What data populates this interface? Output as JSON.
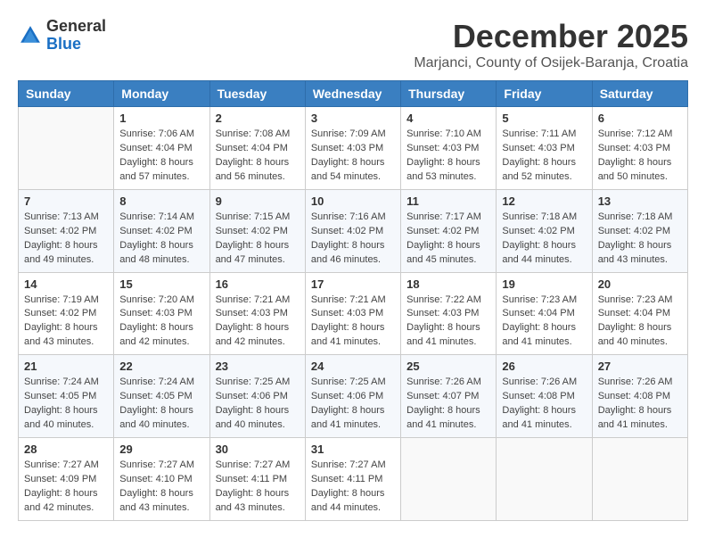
{
  "header": {
    "logo_general": "General",
    "logo_blue": "Blue",
    "month": "December 2025",
    "location": "Marjanci, County of Osijek-Baranja, Croatia"
  },
  "weekdays": [
    "Sunday",
    "Monday",
    "Tuesday",
    "Wednesday",
    "Thursday",
    "Friday",
    "Saturday"
  ],
  "weeks": [
    [
      {
        "day": "",
        "info": ""
      },
      {
        "day": "1",
        "info": "Sunrise: 7:06 AM\nSunset: 4:04 PM\nDaylight: 8 hours\nand 57 minutes."
      },
      {
        "day": "2",
        "info": "Sunrise: 7:08 AM\nSunset: 4:04 PM\nDaylight: 8 hours\nand 56 minutes."
      },
      {
        "day": "3",
        "info": "Sunrise: 7:09 AM\nSunset: 4:03 PM\nDaylight: 8 hours\nand 54 minutes."
      },
      {
        "day": "4",
        "info": "Sunrise: 7:10 AM\nSunset: 4:03 PM\nDaylight: 8 hours\nand 53 minutes."
      },
      {
        "day": "5",
        "info": "Sunrise: 7:11 AM\nSunset: 4:03 PM\nDaylight: 8 hours\nand 52 minutes."
      },
      {
        "day": "6",
        "info": "Sunrise: 7:12 AM\nSunset: 4:03 PM\nDaylight: 8 hours\nand 50 minutes."
      }
    ],
    [
      {
        "day": "7",
        "info": "Sunrise: 7:13 AM\nSunset: 4:02 PM\nDaylight: 8 hours\nand 49 minutes."
      },
      {
        "day": "8",
        "info": "Sunrise: 7:14 AM\nSunset: 4:02 PM\nDaylight: 8 hours\nand 48 minutes."
      },
      {
        "day": "9",
        "info": "Sunrise: 7:15 AM\nSunset: 4:02 PM\nDaylight: 8 hours\nand 47 minutes."
      },
      {
        "day": "10",
        "info": "Sunrise: 7:16 AM\nSunset: 4:02 PM\nDaylight: 8 hours\nand 46 minutes."
      },
      {
        "day": "11",
        "info": "Sunrise: 7:17 AM\nSunset: 4:02 PM\nDaylight: 8 hours\nand 45 minutes."
      },
      {
        "day": "12",
        "info": "Sunrise: 7:18 AM\nSunset: 4:02 PM\nDaylight: 8 hours\nand 44 minutes."
      },
      {
        "day": "13",
        "info": "Sunrise: 7:18 AM\nSunset: 4:02 PM\nDaylight: 8 hours\nand 43 minutes."
      }
    ],
    [
      {
        "day": "14",
        "info": "Sunrise: 7:19 AM\nSunset: 4:02 PM\nDaylight: 8 hours\nand 43 minutes."
      },
      {
        "day": "15",
        "info": "Sunrise: 7:20 AM\nSunset: 4:03 PM\nDaylight: 8 hours\nand 42 minutes."
      },
      {
        "day": "16",
        "info": "Sunrise: 7:21 AM\nSunset: 4:03 PM\nDaylight: 8 hours\nand 42 minutes."
      },
      {
        "day": "17",
        "info": "Sunrise: 7:21 AM\nSunset: 4:03 PM\nDaylight: 8 hours\nand 41 minutes."
      },
      {
        "day": "18",
        "info": "Sunrise: 7:22 AM\nSunset: 4:03 PM\nDaylight: 8 hours\nand 41 minutes."
      },
      {
        "day": "19",
        "info": "Sunrise: 7:23 AM\nSunset: 4:04 PM\nDaylight: 8 hours\nand 41 minutes."
      },
      {
        "day": "20",
        "info": "Sunrise: 7:23 AM\nSunset: 4:04 PM\nDaylight: 8 hours\nand 40 minutes."
      }
    ],
    [
      {
        "day": "21",
        "info": "Sunrise: 7:24 AM\nSunset: 4:05 PM\nDaylight: 8 hours\nand 40 minutes."
      },
      {
        "day": "22",
        "info": "Sunrise: 7:24 AM\nSunset: 4:05 PM\nDaylight: 8 hours\nand 40 minutes."
      },
      {
        "day": "23",
        "info": "Sunrise: 7:25 AM\nSunset: 4:06 PM\nDaylight: 8 hours\nand 40 minutes."
      },
      {
        "day": "24",
        "info": "Sunrise: 7:25 AM\nSunset: 4:06 PM\nDaylight: 8 hours\nand 41 minutes."
      },
      {
        "day": "25",
        "info": "Sunrise: 7:26 AM\nSunset: 4:07 PM\nDaylight: 8 hours\nand 41 minutes."
      },
      {
        "day": "26",
        "info": "Sunrise: 7:26 AM\nSunset: 4:08 PM\nDaylight: 8 hours\nand 41 minutes."
      },
      {
        "day": "27",
        "info": "Sunrise: 7:26 AM\nSunset: 4:08 PM\nDaylight: 8 hours\nand 41 minutes."
      }
    ],
    [
      {
        "day": "28",
        "info": "Sunrise: 7:27 AM\nSunset: 4:09 PM\nDaylight: 8 hours\nand 42 minutes."
      },
      {
        "day": "29",
        "info": "Sunrise: 7:27 AM\nSunset: 4:10 PM\nDaylight: 8 hours\nand 43 minutes."
      },
      {
        "day": "30",
        "info": "Sunrise: 7:27 AM\nSunset: 4:11 PM\nDaylight: 8 hours\nand 43 minutes."
      },
      {
        "day": "31",
        "info": "Sunrise: 7:27 AM\nSunset: 4:11 PM\nDaylight: 8 hours\nand 44 minutes."
      },
      {
        "day": "",
        "info": ""
      },
      {
        "day": "",
        "info": ""
      },
      {
        "day": "",
        "info": ""
      }
    ]
  ]
}
